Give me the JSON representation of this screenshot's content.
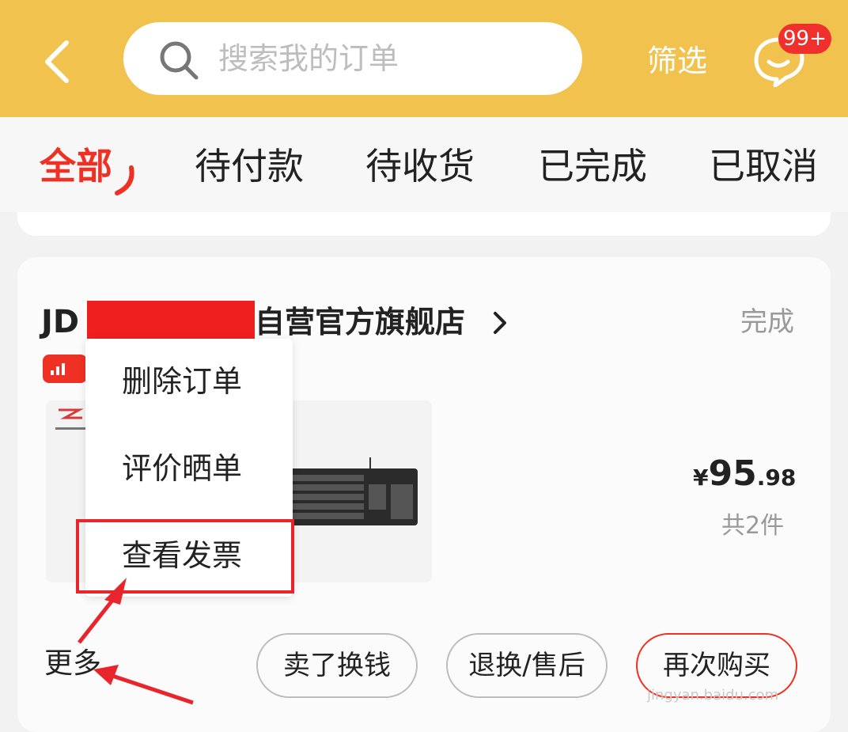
{
  "header": {
    "search_placeholder": "搜索我的订单",
    "filter_label": "筛选",
    "message_badge": "99+"
  },
  "tabs": [
    {
      "label": "全部",
      "active": true
    },
    {
      "label": "待付款",
      "active": false
    },
    {
      "label": "待收货",
      "active": false
    },
    {
      "label": "已完成",
      "active": false
    },
    {
      "label": "已取消",
      "active": false
    }
  ],
  "order": {
    "shop_prefix": "JD",
    "shop_suffix": "自营官方旗舰店",
    "status": "完成",
    "price_currency": "¥",
    "price_integer": "95",
    "price_decimal": ".98",
    "quantity": "共2件"
  },
  "dropdown_menu": {
    "items": [
      "删除订单",
      "评价晒单",
      "查看发票"
    ]
  },
  "footer": {
    "more_label": "更多",
    "buttons": [
      "卖了换钱",
      "退换/售后",
      "再次购买"
    ]
  },
  "watermark": {
    "domain": "jingyan.baidu.com"
  },
  "colors": {
    "header_bg": "#f1c24e",
    "accent_red": "#ee3124",
    "annotation_red": "#e8252b"
  }
}
